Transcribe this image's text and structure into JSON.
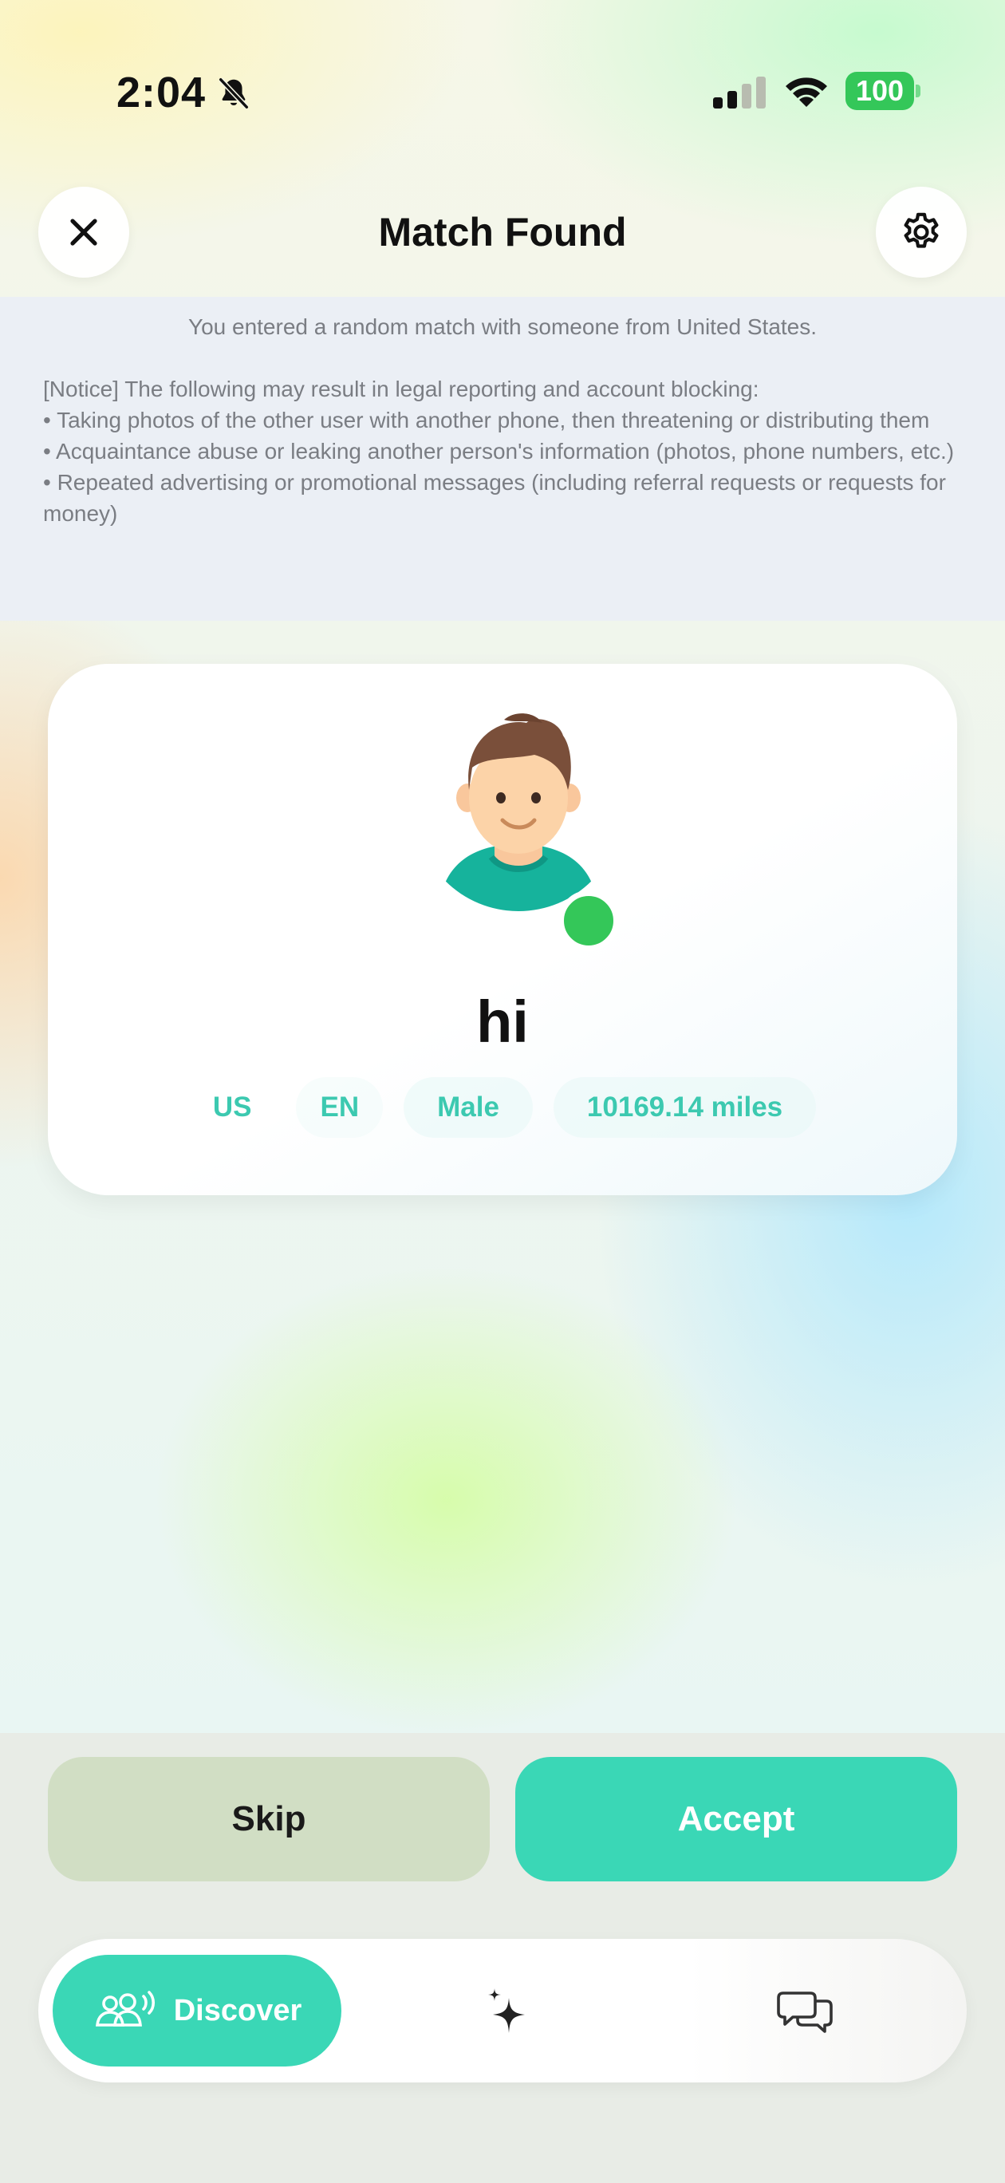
{
  "status_bar": {
    "time": "2:04",
    "battery": "100",
    "icons": [
      "bell-slash-icon",
      "cellular-signal-icon",
      "wifi-icon",
      "battery-icon"
    ]
  },
  "header": {
    "title": "Match Found",
    "left_icon": "close-icon",
    "right_icon": "gear-icon"
  },
  "notice": {
    "intro": "You entered a random match with someone from United States.",
    "heading": "[Notice] The following may result in legal reporting and account blocking:",
    "items": [
      "• Taking photos of the other user with another phone, then threatening or distributing them",
      "• Acquaintance abuse or leaking another person's information (photos, phone numbers, etc.)",
      "• Repeated advertising or promotional messages (including referral requests or requests for money)"
    ]
  },
  "profile": {
    "name": "hi",
    "online": true,
    "tags": [
      "US",
      "EN",
      "Male",
      "10169.14 miles"
    ]
  },
  "actions": {
    "skip": "Skip",
    "accept": "Accept"
  },
  "tabbar": {
    "discover": "Discover",
    "icons": [
      "people-radar-icon",
      "sparkle-icon",
      "chat-bubbles-icon"
    ]
  },
  "colors": {
    "accent": "#3ad7b6",
    "online": "#34c759",
    "tag_text": "#3cc9b0",
    "skip_bg": "#d1dec4"
  }
}
